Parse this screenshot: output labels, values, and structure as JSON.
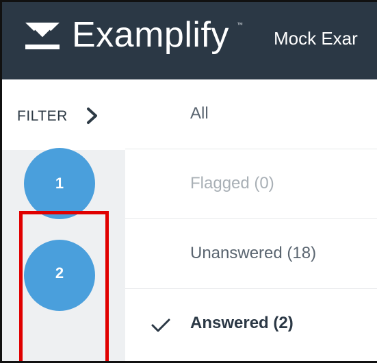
{
  "header": {
    "brand": "Examplify",
    "trademark": "™",
    "exam_title": "Mock Exar",
    "logo_icon": "examplify-logo-icon"
  },
  "filter": {
    "label": "FILTER",
    "icon": "chevron-right-icon"
  },
  "navigator": {
    "up_icon": "chevron-up-icon",
    "questions": [
      "1",
      "2"
    ]
  },
  "filter_menu": {
    "items": [
      {
        "label": "All",
        "state": "normal"
      },
      {
        "label": "Flagged (0)",
        "state": "disabled"
      },
      {
        "label": "Unanswered (18)",
        "state": "normal"
      },
      {
        "label": "Answered (2)",
        "state": "selected",
        "icon": "checkmark-icon"
      }
    ]
  },
  "colors": {
    "header_bg": "#2b3845",
    "question_circle": "#4a9fdc",
    "highlight_box": "#e00000"
  }
}
